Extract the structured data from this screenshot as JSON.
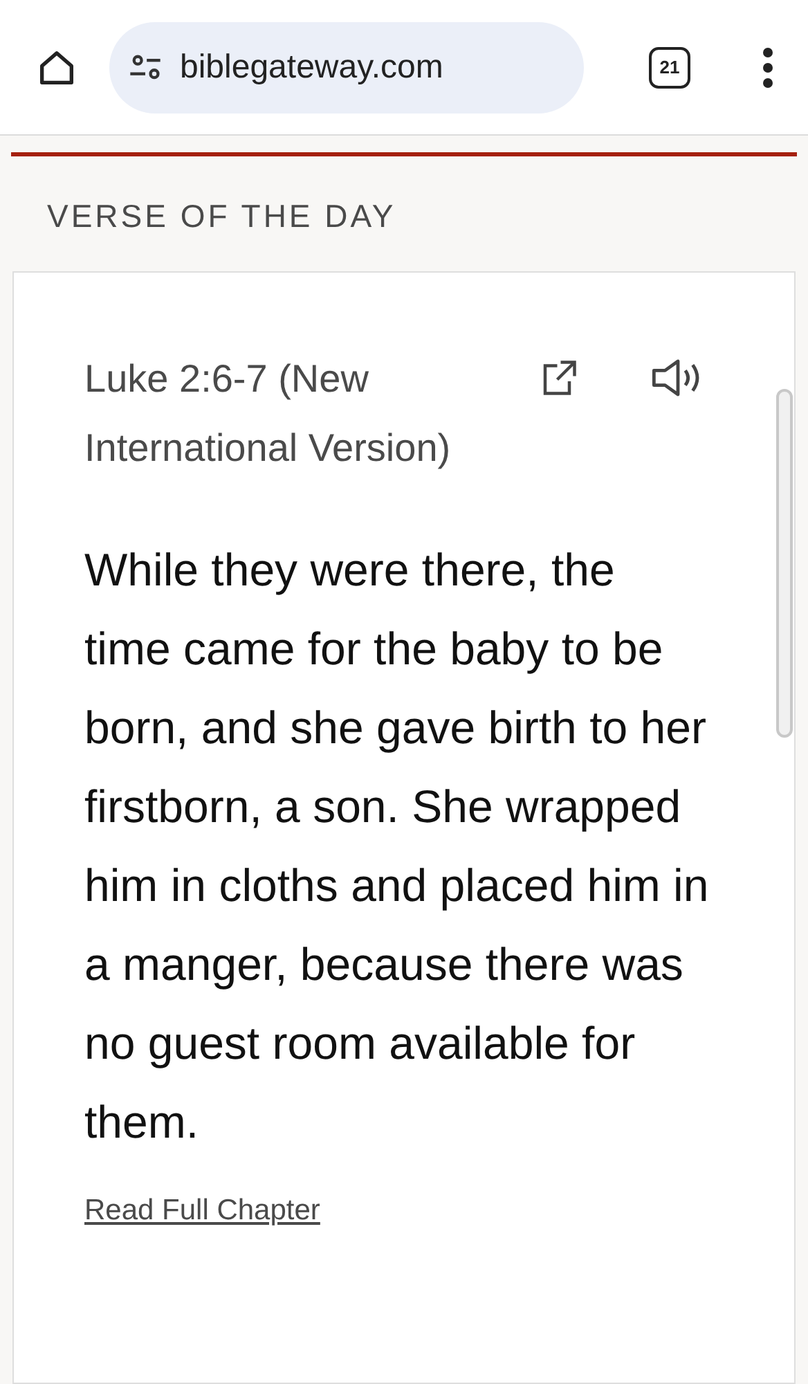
{
  "browser": {
    "url": "biblegateway.com",
    "tab_count": "21"
  },
  "section": {
    "title": "VERSE OF THE DAY"
  },
  "verse": {
    "reference": "Luke 2:6-7 (New International Version)",
    "text": "While they were there, the time came for the baby to be born, and she gave birth to her firstborn, a son. She wrapped him in cloths and placed him in a manger, because there was no guest room available for them.",
    "link": "Read Full Chapter"
  }
}
